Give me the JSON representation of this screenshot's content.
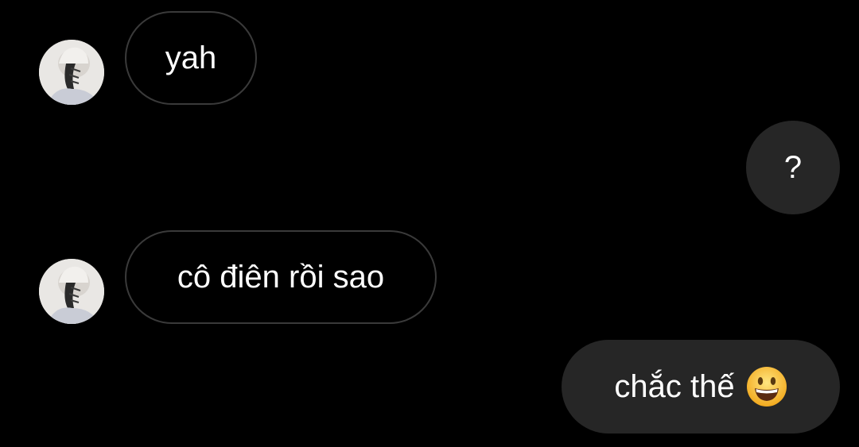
{
  "thread": {
    "messages": [
      {
        "sender": "other",
        "text": "yah",
        "avatar_icon": "profile-avatar"
      },
      {
        "sender": "me",
        "text": "?"
      },
      {
        "sender": "other",
        "text": "cô điên rồi sao",
        "avatar_icon": "profile-avatar"
      },
      {
        "sender": "me",
        "text": "chắc thế",
        "emoji_icon": "grinning-face-emoji"
      }
    ]
  },
  "colors": {
    "background": "#000000",
    "incoming_border": "#3a3a3a",
    "outgoing_bubble": "#262626",
    "text": "#ffffff"
  }
}
